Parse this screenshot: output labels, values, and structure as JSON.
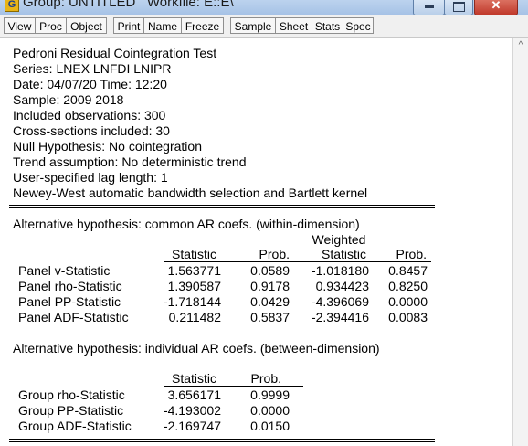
{
  "window": {
    "icon_letter": "G",
    "title": "Group: UNTITLED   Workfile: E::E\\",
    "min_glyph": "",
    "close_glyph": "✕"
  },
  "toolbar": {
    "buttons": [
      "View",
      "Proc",
      "Object",
      "Print",
      "Name",
      "Freeze",
      "Sample",
      "Sheet",
      "Stats",
      "Spec"
    ]
  },
  "header": {
    "lines": [
      "Pedroni Residual Cointegration Test",
      "Series: LNEX LNFDI LNIPR",
      "Date: 04/07/20   Time: 12:20",
      "Sample: 2009 2018",
      "Included observations: 300",
      "Cross-sections included: 30",
      "Null Hypothesis: No cointegration",
      "Trend assumption: No deterministic trend",
      "User-specified lag length: 1",
      "Newey-West automatic bandwidth selection and Bartlett kernel"
    ]
  },
  "within": {
    "title": "Alternative hypothesis: common AR coefs. (within-dimension)",
    "weighted_label": "Weighted",
    "col_statistic": "Statistic",
    "col_prob": "Prob.",
    "col_w_statistic": "Statistic",
    "col_w_prob": "Prob.",
    "rows": [
      {
        "label": "Panel v-Statistic",
        "stat": "1.563771",
        "prob": "0.0589",
        "wstat": "-1.018180",
        "wprob": "0.8457"
      },
      {
        "label": "Panel rho-Statistic",
        "stat": "1.390587",
        "prob": "0.9178",
        "wstat": "0.934423",
        "wprob": "0.8250"
      },
      {
        "label": "Panel PP-Statistic",
        "stat": "-1.718144",
        "prob": "0.0429",
        "wstat": "-4.396069",
        "wprob": "0.0000"
      },
      {
        "label": "Panel ADF-Statistic",
        "stat": "0.211482",
        "prob": "0.5837",
        "wstat": "-2.394416",
        "wprob": "0.0083"
      }
    ]
  },
  "between": {
    "title": "Alternative hypothesis: individual AR coefs. (between-dimension)",
    "col_statistic": "Statistic",
    "col_prob": "Prob.",
    "rows": [
      {
        "label": "Group rho-Statistic",
        "stat": "3.656171",
        "prob": "0.9999"
      },
      {
        "label": "Group PP-Statistic",
        "stat": "-4.193002",
        "prob": "0.0000"
      },
      {
        "label": "Group ADF-Statistic",
        "stat": "-2.169747",
        "prob": "0.0150"
      }
    ]
  },
  "scrollbar": {
    "up_glyph": "^"
  }
}
